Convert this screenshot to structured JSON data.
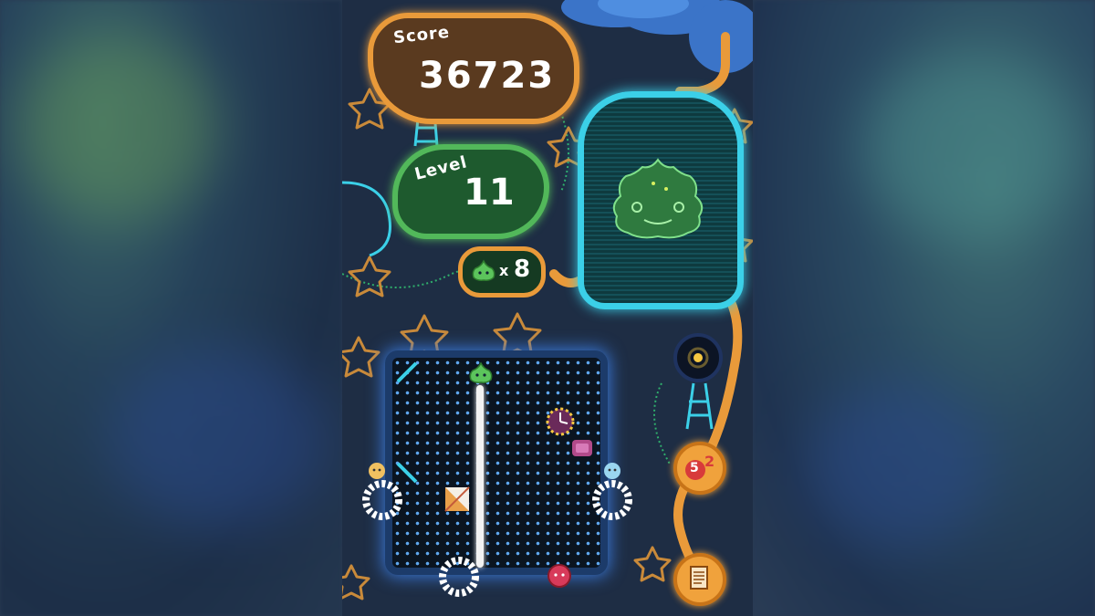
{
  "hud": {
    "score_label": "Score",
    "score_value": "36723",
    "level_label": "Level",
    "level_value": "11",
    "lives_multiplier": "x",
    "lives_value": "8"
  },
  "side_buttons": {
    "bonus_label": "5",
    "bonus_sub": "2"
  },
  "icons": {
    "lives": "green-slime-icon",
    "jar_character": "green-slime-boss-icon",
    "bonus": "red-bomb-icon",
    "menu": "document-icon",
    "orb": "dark-orb-icon"
  },
  "colors": {
    "score_border": "#e99a3a",
    "level_border": "#52b85a",
    "jar_glow": "#3bd0e8",
    "board_glow": "#3a78d8"
  }
}
